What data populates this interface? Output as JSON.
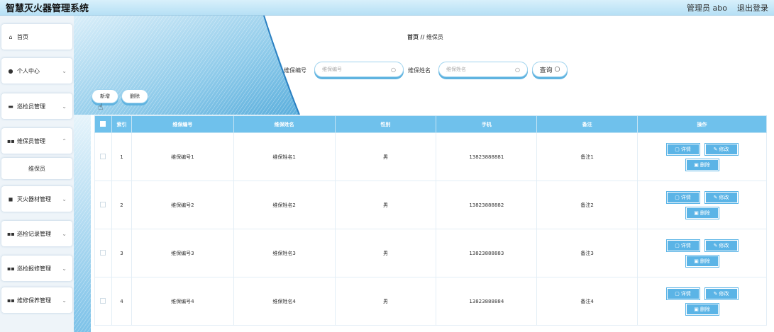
{
  "header": {
    "app_title": "智慧灭火器管理系统",
    "admin_label": "管理员 abo",
    "logout_label": "退出登录"
  },
  "sidebar": {
    "items": [
      {
        "label": "首页",
        "icon": "home-icon"
      },
      {
        "label": "个人中心",
        "icon": "user-icon"
      },
      {
        "label": "巡检员管理",
        "icon": "group-icon"
      },
      {
        "label": "维保员管理",
        "icon": "grid-icon"
      },
      {
        "label": "维保员",
        "icon": ""
      },
      {
        "label": "灭火器材管理",
        "icon": "extinguisher-icon"
      },
      {
        "label": "巡检记录管理",
        "icon": "grid-icon"
      },
      {
        "label": "巡检报修管理",
        "icon": "grid-icon"
      },
      {
        "label": "维修保养管理",
        "icon": "grid-icon"
      }
    ]
  },
  "breadcrumb": {
    "home": "首页",
    "separator": "//",
    "current": "维保员"
  },
  "search": {
    "code_label": "维保编号",
    "code_placeholder": "维保编号",
    "name_label": "维保姓名",
    "name_placeholder": "维保姓名",
    "query_label": "查询"
  },
  "actions": {
    "add_label": "新增",
    "delete_label": "删除"
  },
  "table": {
    "columns": [
      "索引",
      "维保编号",
      "维保姓名",
      "性别",
      "手机",
      "备注",
      "操作"
    ],
    "rows": [
      {
        "index": "1",
        "code": "维保编号1",
        "name": "维保姓名1",
        "gender": "男",
        "phone": "13823888881",
        "remark": "备注1"
      },
      {
        "index": "2",
        "code": "维保编号2",
        "name": "维保姓名2",
        "gender": "男",
        "phone": "13823888882",
        "remark": "备注2"
      },
      {
        "index": "3",
        "code": "维保编号3",
        "name": "维保姓名3",
        "gender": "男",
        "phone": "13823888883",
        "remark": "备注3"
      },
      {
        "index": "4",
        "code": "维保编号4",
        "name": "维保姓名4",
        "gender": "男",
        "phone": "13823888884",
        "remark": "备注4"
      }
    ],
    "row_actions": {
      "detail_label": "详情",
      "edit_label": "修改",
      "delete_label": "删除"
    }
  },
  "colors": {
    "accent": "#6fc1ec",
    "button_blue": "#5bb4e6",
    "topbar": "#c6e8f7"
  }
}
